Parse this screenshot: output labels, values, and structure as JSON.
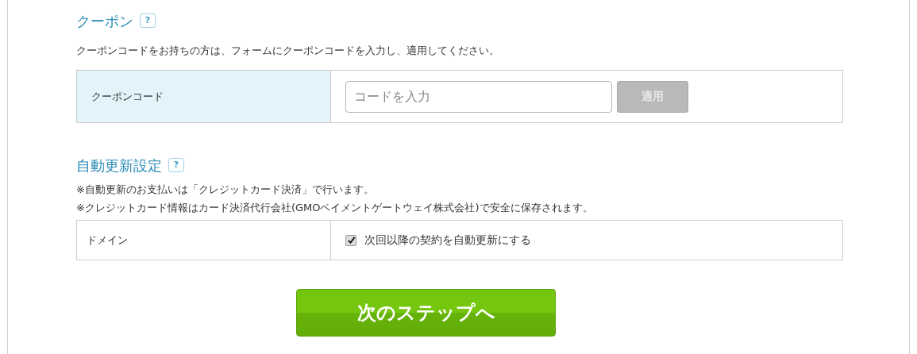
{
  "coupon": {
    "title": "クーポン",
    "help": "?",
    "description": "クーポンコードをお持ちの方は、フォームにクーポンコードを入力し、適用してください。",
    "label": "クーポンコード",
    "field": {
      "placeholder": "コードを入力"
    },
    "apply_button": {
      "label": "適用",
      "disabled": true
    }
  },
  "auto_renew": {
    "title": "自動更新設定",
    "help": "?",
    "notes": [
      "※自動更新のお支払いは「クレジットカード決済」で行います。",
      "※クレジットカード情報はカード決済代行会社(GMOペイメントゲートウェイ株式会社)で安全に保存されます。"
    ],
    "label": "ドメイン",
    "checkbox": {
      "label": "次回以降の契約を自動更新にする",
      "checked": true
    }
  },
  "next_button": {
    "label": "次のステップへ"
  }
}
